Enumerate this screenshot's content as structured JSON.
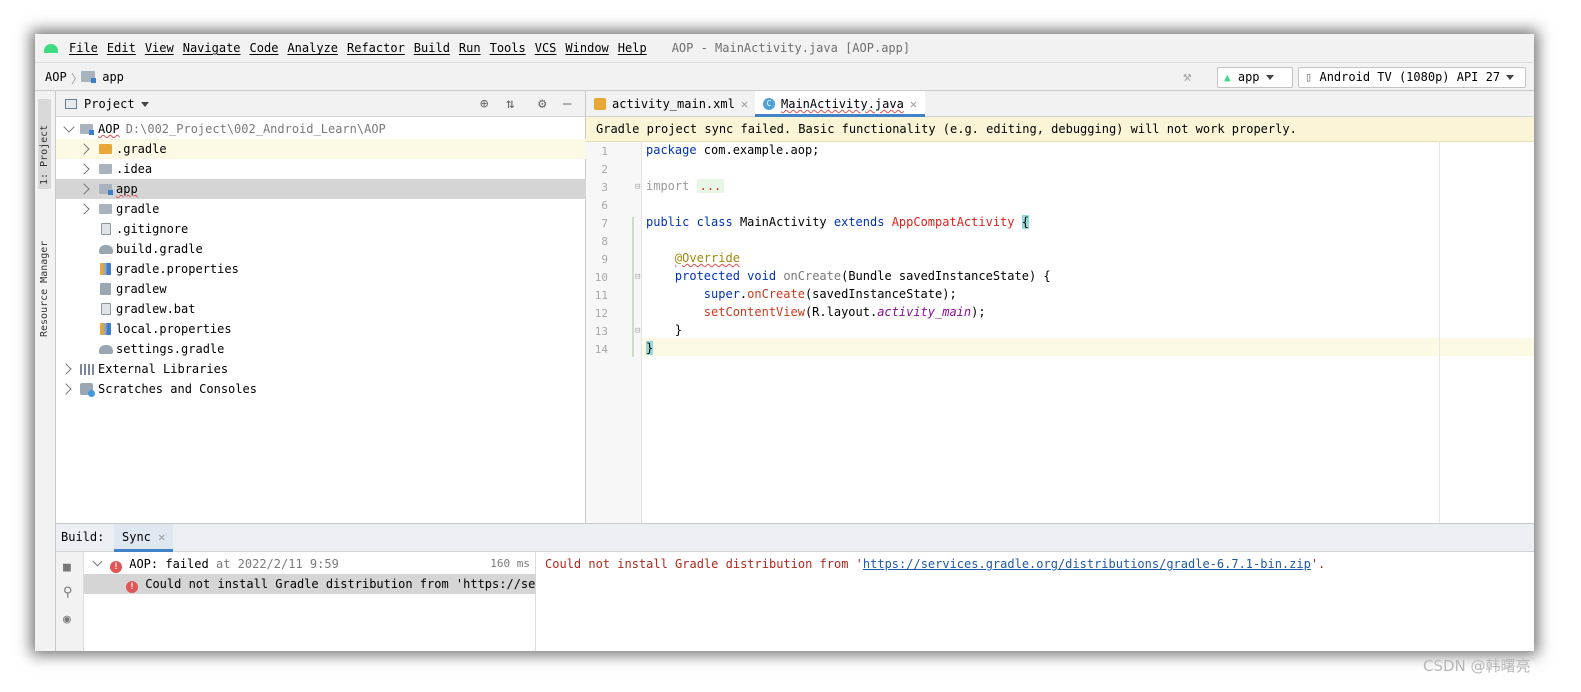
{
  "menubar": {
    "items": [
      "File",
      "Edit",
      "View",
      "Navigate",
      "Code",
      "Analyze",
      "Refactor",
      "Build",
      "Run",
      "Tools",
      "VCS",
      "Window",
      "Help"
    ],
    "window_title": "AOP - MainActivity.java [AOP.app]"
  },
  "navbar": {
    "crumb_project": "AOP",
    "crumb_module": "app",
    "run_config": "app",
    "device": "Android TV (1080p) API 27"
  },
  "left_strip": {
    "project_tab": "1: Project",
    "resource_tab": "Resource Manager"
  },
  "project_panel": {
    "title": "Project",
    "root_name": "AOP",
    "root_path": "D:\\002_Project\\002_Android_Learn\\AOP",
    "items": [
      {
        "label": ".gradle"
      },
      {
        "label": ".idea"
      },
      {
        "label": "app"
      },
      {
        "label": "gradle"
      },
      {
        "label": ".gitignore"
      },
      {
        "label": "build.gradle"
      },
      {
        "label": "gradle.properties"
      },
      {
        "label": "gradlew"
      },
      {
        "label": "gradlew.bat"
      },
      {
        "label": "local.properties"
      },
      {
        "label": "settings.gradle"
      }
    ],
    "external_libraries": "External Libraries",
    "scratches": "Scratches and Consoles"
  },
  "editor": {
    "tabs": [
      {
        "label": "activity_main.xml",
        "active": false
      },
      {
        "label": "MainActivity.java",
        "active": true
      }
    ],
    "sync_banner": "Gradle project sync failed. Basic functionality (e.g. editing, debugging) will not work properly.",
    "line_numbers": [
      "1",
      "2",
      "3",
      "6",
      "7",
      "8",
      "9",
      "10",
      "11",
      "12",
      "13",
      "14"
    ],
    "code": {
      "l1_kw": "package",
      "l1_rest": " com.example.aop;",
      "l3_kw": "import",
      "l3_dots": "...",
      "l7_kw1": "public",
      "l7_kw2": "class",
      "l7_name": " MainActivity ",
      "l7_kw3": "extends",
      "l7_super": "AppCompatActivity",
      "l7_brace": "{",
      "l9_ann": "@Override",
      "l10_kw1": "protected",
      "l10_kw2": "void",
      "l10_meth": "onCreate",
      "l10_rest": "(Bundle savedInstanceState) {",
      "l11_kw": "super",
      "l11_meth": "onCreate",
      "l11_rest": "(savedInstanceState);",
      "l12_meth": "setContentView",
      "l12_mid": "(R.layout.",
      "l12_field": "activity_main",
      "l12_end": ");",
      "l13": "}",
      "l14": "}"
    }
  },
  "build_panel": {
    "label": "Build:",
    "tab": "Sync",
    "row1_project": "AOP:",
    "row1_status": "failed",
    "row1_time": "at 2022/2/11 9:59",
    "row1_duration": "160 ms",
    "row2_message": "Could not install Gradle distribution from 'https://services.gradle.org/distributions/gradle-6.7.1-bin.zip'.",
    "output_prefix": "Could not install Gradle distribution from '",
    "output_link": "https://services.gradle.org/distributions/gradle-6.7.1-bin.zip",
    "output_suffix": "'."
  },
  "watermark": "CSDN @韩曙亮",
  "colors": {
    "accent_tab": "#4083c9",
    "error_text": "#b0281e",
    "banner_bg": "#faf5d7",
    "keyword": "#0033b3"
  }
}
